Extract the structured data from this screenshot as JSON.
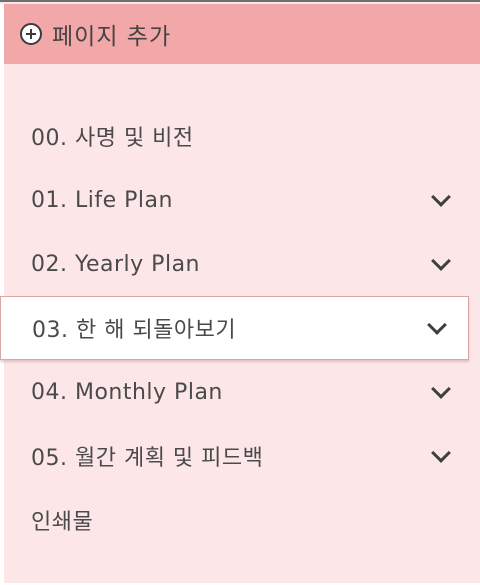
{
  "add_page": {
    "label": "페이지 추가",
    "icon": "plus-circle-icon"
  },
  "pages": [
    {
      "label": "00. 사명 및 비전",
      "has_chevron": false
    },
    {
      "label": "01. Life Plan",
      "has_chevron": true
    },
    {
      "label": "02. Yearly Plan",
      "has_chevron": true
    },
    {
      "label": "03. 한 해 되돌아보기",
      "has_chevron": true,
      "selected": true
    },
    {
      "label": "04. Monthly Plan",
      "has_chevron": true
    },
    {
      "label": "05. 월간 계획 및 피드백",
      "has_chevron": true
    },
    {
      "label": "인쇄물",
      "has_chevron": false
    }
  ],
  "colors": {
    "header_bg": "#f2a7a8",
    "panel_bg": "#fde6e7",
    "selected_bg": "#ffffff",
    "text": "#4a4a4a"
  }
}
